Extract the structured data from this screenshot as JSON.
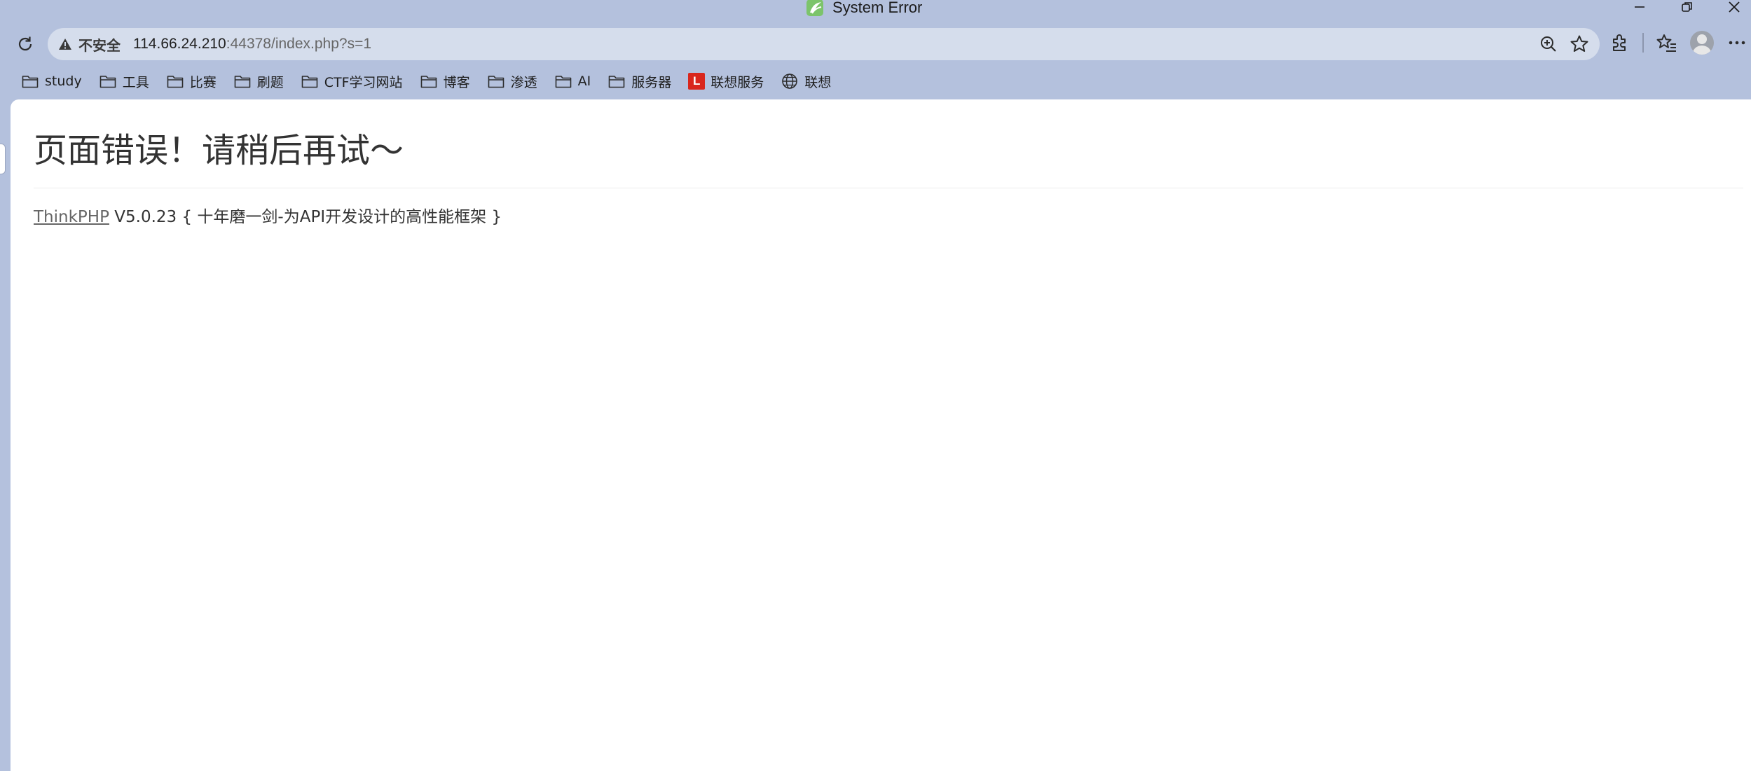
{
  "window": {
    "title": "System Error"
  },
  "addressbar": {
    "security_label": "不安全",
    "url_host": "114.66.24.210",
    "url_rest": ":44378/index.php?s=1"
  },
  "bookmarks": [
    {
      "label": "study",
      "icon": "folder-icon"
    },
    {
      "label": "工具",
      "icon": "folder-icon"
    },
    {
      "label": "比赛",
      "icon": "folder-icon"
    },
    {
      "label": "刷题",
      "icon": "folder-icon"
    },
    {
      "label": "CTF学习网站",
      "icon": "folder-icon"
    },
    {
      "label": "博客",
      "icon": "folder-icon"
    },
    {
      "label": "渗透",
      "icon": "folder-icon"
    },
    {
      "label": "AI",
      "icon": "folder-icon"
    },
    {
      "label": "服务器",
      "icon": "folder-icon"
    },
    {
      "label": "联想服务",
      "icon": "lenovo-icon",
      "badge": "L"
    },
    {
      "label": "联想",
      "icon": "globe-icon"
    }
  ],
  "page": {
    "error_title": "页面错误！请稍后再试～",
    "framework_link": "ThinkPHP",
    "framework_version": "V5.0.23",
    "slogan": "{ 十年磨一剑-为API开发设计的高性能框架 }"
  },
  "colors": {
    "chrome_bg": "#b4c1dd",
    "omnibox_bg": "#d5ddec",
    "lenovo_red": "#d9261c",
    "text": "#333333",
    "link": "#666666"
  }
}
